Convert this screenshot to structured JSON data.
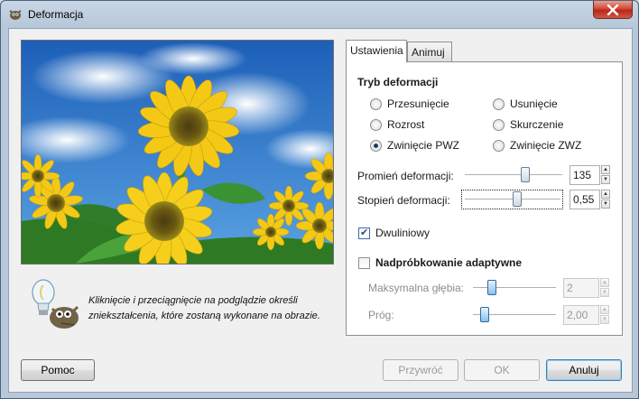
{
  "window": {
    "title": "Deformacja"
  },
  "hint": {
    "line1": "Kliknięcie i przeciągnięcie na podglądzie określi",
    "line2": "zniekształcenia, które zostaną wykonane na obrazie."
  },
  "tabs": [
    {
      "label": "Ustawienia",
      "active": true
    },
    {
      "label": "Animuj",
      "active": false
    }
  ],
  "mode": {
    "title": "Tryb deformacji",
    "options": [
      {
        "label": "Przesunięcie",
        "selected": false
      },
      {
        "label": "Usunięcie",
        "selected": false
      },
      {
        "label": "Rozrost",
        "selected": false
      },
      {
        "label": "Skurczenie",
        "selected": false
      },
      {
        "label": "Zwinięcie PWZ",
        "selected": true
      },
      {
        "label": "Zwinięcie ZWZ",
        "selected": false
      }
    ]
  },
  "radius": {
    "label": "Promień deformacji:",
    "value": "135",
    "fraction": 0.63
  },
  "amount": {
    "label": "Stopień deformacji:",
    "value": "0,55",
    "fraction": 0.55
  },
  "bilinear": {
    "label": "Dwuliniowy",
    "checked": true
  },
  "supersample": {
    "label": "Nadpróbkowanie adaptywne",
    "checked": false
  },
  "max_depth": {
    "label": "Maksymalna głębia:",
    "value": "2",
    "fraction": 0.2,
    "enabled": false
  },
  "threshold": {
    "label": "Próg:",
    "value": "2,00",
    "fraction": 0.1,
    "enabled": false
  },
  "buttons": {
    "help": "Pomoc",
    "reset": "Przywróć",
    "ok": "OK",
    "cancel": "Anuluj"
  },
  "colors": {
    "frame": "#b7c8da",
    "close": "#c8392b",
    "radio_selected": "#1c3a5e"
  }
}
